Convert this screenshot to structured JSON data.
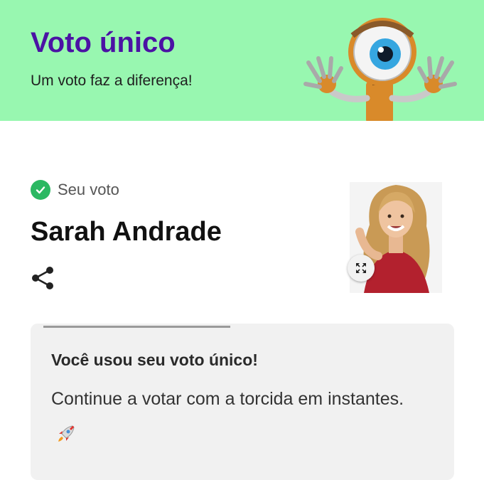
{
  "header": {
    "title": "Voto único",
    "subtitle": "Um voto faz a diferença!",
    "background_color": "#98f7b0",
    "title_color": "#4b12a4",
    "mascot_icon": "big-brother-eye-mascot"
  },
  "vote": {
    "status_icon": "check-circle-icon",
    "label": "Seu voto",
    "candidate_name": "Sarah Andrade",
    "share_icon": "share-icon",
    "photo_expand_icon": "expand-icon"
  },
  "card": {
    "progress_fraction": 0.47,
    "title": "Você usou seu voto único!",
    "text": "Continue a votar com a torcida em instantes.",
    "emoji_icon": "rocket-icon"
  }
}
